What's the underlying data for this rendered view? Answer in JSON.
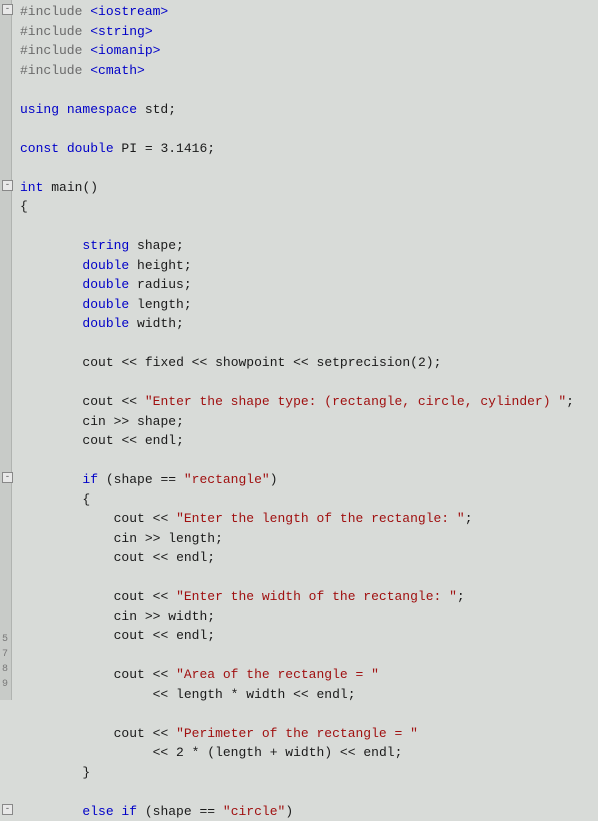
{
  "code": {
    "lines": [
      {
        "fold": "-",
        "seg": [
          [
            "pp",
            "#include "
          ],
          [
            "pp-angle",
            "<iostream>"
          ]
        ]
      },
      {
        "seg": [
          [
            "pp",
            "#include "
          ],
          [
            "pp-angle",
            "<string>"
          ]
        ]
      },
      {
        "seg": [
          [
            "pp",
            "#include "
          ],
          [
            "pp-angle",
            "<iomanip>"
          ]
        ]
      },
      {
        "seg": [
          [
            "pp",
            "#include "
          ],
          [
            "pp-angle",
            "<cmath>"
          ]
        ]
      },
      {
        "blank": true
      },
      {
        "seg": [
          [
            "kw",
            "using "
          ],
          [
            "kw",
            "namespace "
          ],
          [
            "ident",
            "std"
          ],
          [
            "punc",
            ";"
          ]
        ]
      },
      {
        "blank": true
      },
      {
        "seg": [
          [
            "kw",
            "const "
          ],
          [
            "kw",
            "double "
          ],
          [
            "ident",
            "PI"
          ],
          [
            "op",
            " = "
          ],
          [
            "num",
            "3.1416"
          ],
          [
            "punc",
            ";"
          ]
        ]
      },
      {
        "blank": true
      },
      {
        "fold": "-",
        "seg": [
          [
            "kw",
            "int "
          ],
          [
            "ident",
            "main"
          ],
          [
            "punc",
            "()"
          ]
        ]
      },
      {
        "seg": [
          [
            "punc",
            "{"
          ]
        ]
      },
      {
        "blank": true
      },
      {
        "indent": 2,
        "seg": [
          [
            "type",
            "string "
          ],
          [
            "ident",
            "shape"
          ],
          [
            "punc",
            ";"
          ]
        ]
      },
      {
        "indent": 2,
        "seg": [
          [
            "kw",
            "double "
          ],
          [
            "ident",
            "height"
          ],
          [
            "punc",
            ";"
          ]
        ]
      },
      {
        "indent": 2,
        "seg": [
          [
            "kw",
            "double "
          ],
          [
            "ident",
            "radius"
          ],
          [
            "punc",
            ";"
          ]
        ]
      },
      {
        "indent": 2,
        "seg": [
          [
            "kw",
            "double "
          ],
          [
            "ident",
            "length"
          ],
          [
            "punc",
            ";"
          ]
        ]
      },
      {
        "indent": 2,
        "seg": [
          [
            "kw",
            "double "
          ],
          [
            "ident",
            "width"
          ],
          [
            "punc",
            ";"
          ]
        ]
      },
      {
        "blank": true
      },
      {
        "indent": 2,
        "seg": [
          [
            "ident",
            "cout"
          ],
          [
            "op",
            " << "
          ],
          [
            "ident",
            "fixed"
          ],
          [
            "op",
            " << "
          ],
          [
            "ident",
            "showpoint"
          ],
          [
            "op",
            " << "
          ],
          [
            "ident",
            "setprecision"
          ],
          [
            "punc",
            "("
          ],
          [
            "num",
            "2"
          ],
          [
            "punc",
            ");"
          ]
        ]
      },
      {
        "blank": true
      },
      {
        "indent": 2,
        "seg": [
          [
            "ident",
            "cout"
          ],
          [
            "op",
            " << "
          ],
          [
            "str",
            "\"Enter the shape type: (rectangle, circle, cylinder) \""
          ],
          [
            "punc",
            ";"
          ]
        ]
      },
      {
        "indent": 2,
        "seg": [
          [
            "ident",
            "cin"
          ],
          [
            "op",
            " >> "
          ],
          [
            "ident",
            "shape"
          ],
          [
            "punc",
            ";"
          ]
        ]
      },
      {
        "indent": 2,
        "seg": [
          [
            "ident",
            "cout"
          ],
          [
            "op",
            " << "
          ],
          [
            "ident",
            "endl"
          ],
          [
            "punc",
            ";"
          ]
        ]
      },
      {
        "blank": true
      },
      {
        "fold": "-",
        "indent": 2,
        "seg": [
          [
            "kw",
            "if "
          ],
          [
            "punc",
            "("
          ],
          [
            "ident",
            "shape"
          ],
          [
            "op",
            " == "
          ],
          [
            "str",
            "\"rectangle\""
          ],
          [
            "punc",
            ")"
          ]
        ]
      },
      {
        "indent": 2,
        "seg": [
          [
            "punc",
            "{"
          ]
        ]
      },
      {
        "indent": 3,
        "seg": [
          [
            "ident",
            "cout"
          ],
          [
            "op",
            " << "
          ],
          [
            "str",
            "\"Enter the length of the rectangle: \""
          ],
          [
            "punc",
            ";"
          ]
        ]
      },
      {
        "indent": 3,
        "seg": [
          [
            "ident",
            "cin"
          ],
          [
            "op",
            " >> "
          ],
          [
            "ident",
            "length"
          ],
          [
            "punc",
            ";"
          ]
        ]
      },
      {
        "indent": 3,
        "seg": [
          [
            "ident",
            "cout"
          ],
          [
            "op",
            " << "
          ],
          [
            "ident",
            "endl"
          ],
          [
            "punc",
            ";"
          ]
        ]
      },
      {
        "blank": true
      },
      {
        "indent": 3,
        "seg": [
          [
            "ident",
            "cout"
          ],
          [
            "op",
            " << "
          ],
          [
            "str",
            "\"Enter the width of the rectangle: \""
          ],
          [
            "punc",
            ";"
          ]
        ]
      },
      {
        "indent": 3,
        "seg": [
          [
            "ident",
            "cin"
          ],
          [
            "op",
            " >> "
          ],
          [
            "ident",
            "width"
          ],
          [
            "punc",
            ";"
          ]
        ]
      },
      {
        "indent": 3,
        "seg": [
          [
            "ident",
            "cout"
          ],
          [
            "op",
            " << "
          ],
          [
            "ident",
            "endl"
          ],
          [
            "punc",
            ";"
          ]
        ]
      },
      {
        "blank": true
      },
      {
        "indent": 3,
        "seg": [
          [
            "ident",
            "cout"
          ],
          [
            "op",
            " << "
          ],
          [
            "str",
            "\"Area of the rectangle = \""
          ]
        ]
      },
      {
        "indent": 4,
        "seg": [
          [
            "op",
            " << "
          ],
          [
            "ident",
            "length"
          ],
          [
            "op",
            " * "
          ],
          [
            "ident",
            "width"
          ],
          [
            "op",
            " << "
          ],
          [
            "ident",
            "endl"
          ],
          [
            "punc",
            ";"
          ]
        ]
      },
      {
        "blank": true
      },
      {
        "indent": 3,
        "seg": [
          [
            "ident",
            "cout"
          ],
          [
            "op",
            " << "
          ],
          [
            "str",
            "\"Perimeter of the rectangle = \""
          ]
        ]
      },
      {
        "indent": 4,
        "seg": [
          [
            "op",
            " << "
          ],
          [
            "num",
            "2"
          ],
          [
            "op",
            " * "
          ],
          [
            "punc",
            "("
          ],
          [
            "ident",
            "length"
          ],
          [
            "op",
            " + "
          ],
          [
            "ident",
            "width"
          ],
          [
            "punc",
            ")"
          ],
          [
            "op",
            " << "
          ],
          [
            "ident",
            "endl"
          ],
          [
            "punc",
            ";"
          ]
        ]
      },
      {
        "indent": 2,
        "seg": [
          [
            "punc",
            "}"
          ]
        ]
      },
      {
        "blank": true
      },
      {
        "fold": "-",
        "indent": 2,
        "seg": [
          [
            "kw",
            "else if "
          ],
          [
            "punc",
            "("
          ],
          [
            "ident",
            "shape"
          ],
          [
            "op",
            " == "
          ],
          [
            "str",
            "\"circle\""
          ],
          [
            "punc",
            ")"
          ]
        ]
      }
    ]
  },
  "gutter_line_numbers": [
    "5",
    "7",
    "8",
    "9"
  ]
}
